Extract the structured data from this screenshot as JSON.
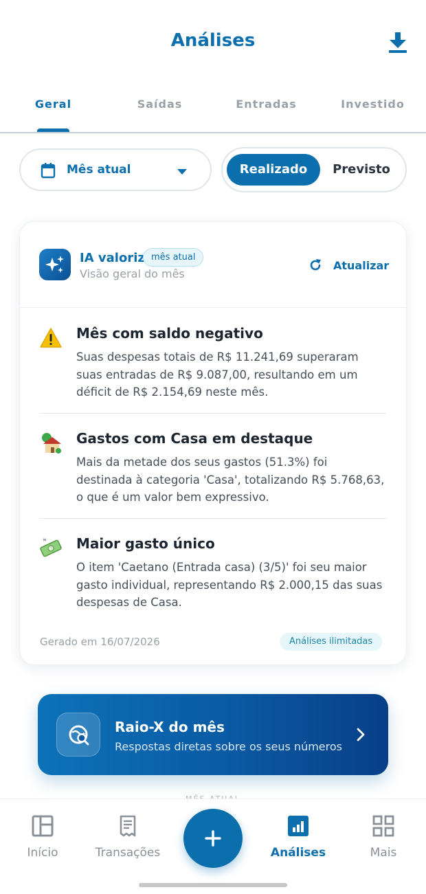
{
  "header": {
    "title": "Análises"
  },
  "tabs": [
    {
      "label": "Geral",
      "active": true
    },
    {
      "label": "Saídas",
      "active": false
    },
    {
      "label": "Entradas",
      "active": false
    },
    {
      "label": "Investido",
      "active": false
    }
  ],
  "filters": {
    "period": "Mês atual",
    "segment": {
      "options": [
        "Realizado",
        "Previsto"
      ],
      "selected": "Realizado"
    }
  },
  "ai_card": {
    "title": "IA valoriz",
    "badge": "mês atual",
    "subtitle": "Visão geral do mês",
    "refresh_label": "Atualizar",
    "insights": [
      {
        "icon": "warning-icon",
        "title": "Mês com saldo negativo",
        "body": "Suas despesas totais de R$ 11.241,69 superaram suas entradas de R$ 9.087,00, resultando em um déficit de R$ 2.154,69 neste mês."
      },
      {
        "icon": "house-icon",
        "title": "Gastos com Casa em destaque",
        "body": "Mais da metade dos seus gastos (51.3%) foi destinada à categoria 'Casa', totalizando R$ 5.768,63, o que é um valor bem expressivo."
      },
      {
        "icon": "money-icon",
        "title": "Maior gasto único",
        "body": "O item 'Caetano (Entrada casa) (3/5)' foi seu maior gasto individual, representando R$ 2.000,15 das suas despesas de Casa."
      }
    ],
    "generated": "Gerado em 16/07/2026",
    "limit_badge": "Análises ilimitadas"
  },
  "raio_x": {
    "title": "Raio-X do mês",
    "subtitle": "Respostas diretas sobre os seus números"
  },
  "peek_text": "MÊS ATUAL",
  "nav": [
    {
      "label": "Início",
      "icon": "layout-icon",
      "active": false
    },
    {
      "label": "Transações",
      "icon": "receipt-icon",
      "active": false
    },
    {
      "label": "Análises",
      "icon": "chart-icon",
      "active": true
    },
    {
      "label": "Mais",
      "icon": "grid-icon",
      "active": false
    }
  ],
  "colors": {
    "primary": "#0b6fae",
    "badge_bg": "#e6f6fa",
    "text": "#1c2430",
    "muted": "#9aa0a7"
  }
}
